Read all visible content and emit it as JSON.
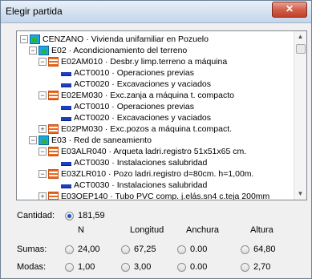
{
  "window": {
    "title": "Elegir partida",
    "close_glyph": "✕"
  },
  "tree": {
    "nodes": [
      {
        "expander": "−",
        "icon": "house",
        "text": "CENZANO · Vivienda unifamiliar en Pozuelo"
      },
      {
        "expander": "−",
        "icon": "house",
        "text": "E02 · Acondicionamiento del terreno"
      },
      {
        "expander": "−",
        "icon": "list",
        "text": "E02AM010 · Desbr.y limp.terreno a máquina"
      },
      {
        "expander": "",
        "icon": "act",
        "text": "ACT0010 · Operaciones previas"
      },
      {
        "expander": "",
        "icon": "act",
        "text": "ACT0020 · Excavaciones y vaciados"
      },
      {
        "expander": "−",
        "icon": "list",
        "text": "E02EM030 · Exc.zanja a máquina t. compacto"
      },
      {
        "expander": "",
        "icon": "act",
        "text": "ACT0010 · Operaciones previas"
      },
      {
        "expander": "",
        "icon": "act",
        "text": "ACT0020 · Excavaciones y vaciados"
      },
      {
        "expander": "+",
        "icon": "list",
        "text": "E02PM030 · Exc.pozos a máquina t.compact."
      },
      {
        "expander": "−",
        "icon": "house",
        "text": "E03 · Red de saneamiento"
      },
      {
        "expander": "−",
        "icon": "list",
        "text": "E03ALR040 · Arqueta ladri.registro 51x51x65 cm."
      },
      {
        "expander": "",
        "icon": "act",
        "text": "ACT0030 · Instalaciones salubridad"
      },
      {
        "expander": "−",
        "icon": "list",
        "text": "E03ZLR010 · Pozo ladri.registro d=80cm. h=1,00m."
      },
      {
        "expander": "",
        "icon": "act",
        "text": "ACT0030 · Instalaciones salubridad"
      },
      {
        "expander": "+",
        "icon": "list",
        "text": "E03OEP140 · Tubo PVC comp. j.elás.sn4 c.teja  200mm"
      }
    ]
  },
  "panel": {
    "cantidad_label": "Cantidad:",
    "cantidad_value": "181,59",
    "columns": [
      "N",
      "Longitud",
      "Anchura",
      "Altura"
    ],
    "sumas_label": "Sumas:",
    "sumas": [
      "24,00",
      "67,25",
      "0.00",
      "64,80"
    ],
    "modas_label": "Modas:",
    "modas": [
      "1,00",
      "3,00",
      "0.00",
      "2,70"
    ]
  },
  "colors": {
    "house_icon": "#18a8e8",
    "list_icon": "#e86a1c",
    "act_icon": "#1c3fbf"
  }
}
